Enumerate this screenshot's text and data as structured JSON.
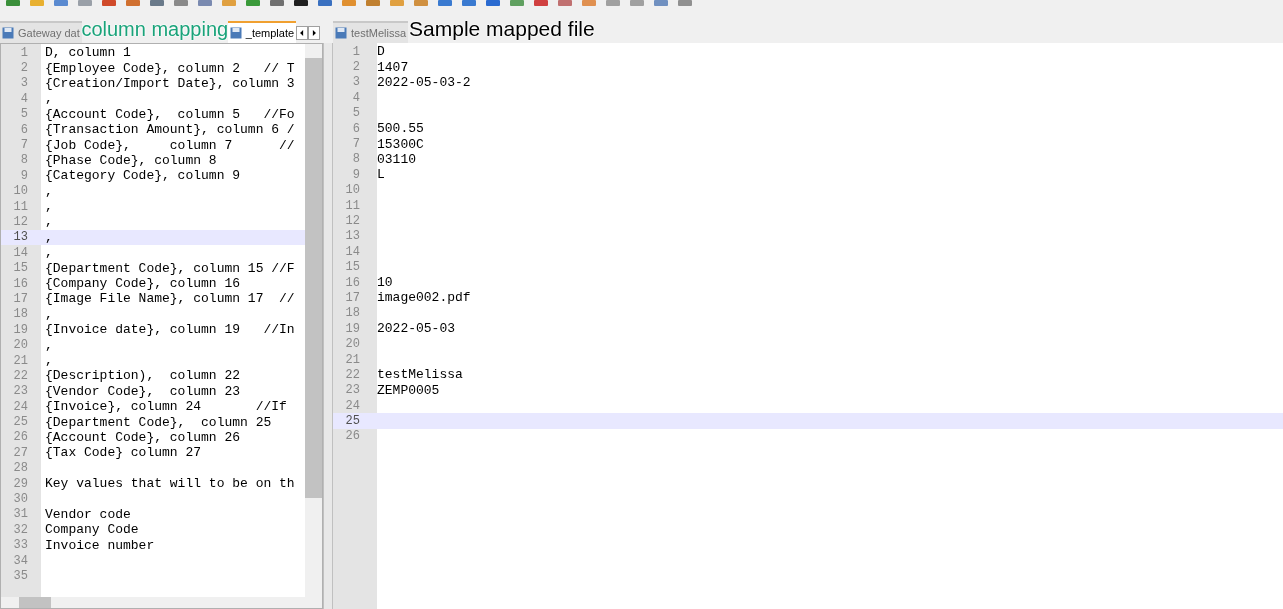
{
  "annotations": [
    {
      "text": "column mapping",
      "kind": "green"
    },
    {
      "text": "Sample mapped file",
      "kind": "dark"
    }
  ],
  "left_pane": {
    "tabs": [
      {
        "label": "Gateway dat",
        "selected": false
      },
      {
        "label": "_template",
        "selected": true
      }
    ],
    "lines": [
      {
        "n": "1",
        "text": "D, column 1",
        "selected": false
      },
      {
        "n": "2",
        "text": "{Employee Code}, column 2   // T",
        "selected": false
      },
      {
        "n": "3",
        "text": "{Creation/Import Date}, column 3",
        "selected": false
      },
      {
        "n": "4",
        "text": ",",
        "selected": false
      },
      {
        "n": "5",
        "text": "{Account Code},  column 5   //Fo",
        "selected": false
      },
      {
        "n": "6",
        "text": "{Transaction Amount}, column 6 /",
        "selected": false
      },
      {
        "n": "7",
        "text": "{Job Code},     column 7      //",
        "selected": false
      },
      {
        "n": "8",
        "text": "{Phase Code}, column 8",
        "selected": false
      },
      {
        "n": "9",
        "text": "{Category Code}, column 9",
        "selected": false
      },
      {
        "n": "10",
        "text": ",",
        "selected": false
      },
      {
        "n": "11",
        "text": ",",
        "selected": false
      },
      {
        "n": "12",
        "text": ",",
        "selected": false
      },
      {
        "n": "13",
        "text": ",",
        "selected": true
      },
      {
        "n": "14",
        "text": ",",
        "selected": false
      },
      {
        "n": "15",
        "text": "{Department Code}, column 15 //F",
        "selected": false
      },
      {
        "n": "16",
        "text": "{Company Code}, column 16",
        "selected": false
      },
      {
        "n": "17",
        "text": "{Image File Name}, column 17  //",
        "selected": false
      },
      {
        "n": "18",
        "text": ",",
        "selected": false
      },
      {
        "n": "19",
        "text": "{Invoice date}, column 19   //In",
        "selected": false
      },
      {
        "n": "20",
        "text": ",",
        "selected": false
      },
      {
        "n": "21",
        "text": ",",
        "selected": false
      },
      {
        "n": "22",
        "text": "{Description),  column 22",
        "selected": false
      },
      {
        "n": "23",
        "text": "{Vendor Code},  column 23",
        "selected": false
      },
      {
        "n": "24",
        "text": "{Invoice}, column 24       //If",
        "selected": false
      },
      {
        "n": "25",
        "text": "{Department Code},  column 25",
        "selected": false
      },
      {
        "n": "26",
        "text": "{Account Code}, column 26",
        "selected": false
      },
      {
        "n": "27",
        "text": "{Tax Code} column 27",
        "selected": false
      },
      {
        "n": "28",
        "selected": false
      },
      {
        "n": "29",
        "text": "Key values that will to be on th",
        "selected": false
      },
      {
        "n": "30",
        "selected": false
      },
      {
        "n": "31",
        "text": "Vendor code",
        "selected": false
      },
      {
        "n": "32",
        "text": "Company Code",
        "selected": false
      },
      {
        "n": "33",
        "text": "Invoice number",
        "selected": false
      },
      {
        "n": "34",
        "selected": false
      },
      {
        "n": "35",
        "selected": false
      }
    ]
  },
  "right_pane": {
    "tabs": [
      {
        "label": "testMelissa",
        "selected": false
      }
    ],
    "lines": [
      {
        "n": "1",
        "text": "D",
        "selected": false
      },
      {
        "n": "2",
        "text": "1407",
        "selected": false
      },
      {
        "n": "3",
        "text": "2022-05-03-2",
        "selected": false
      },
      {
        "n": "4",
        "selected": false
      },
      {
        "n": "5",
        "selected": false
      },
      {
        "n": "6",
        "text": "500.55",
        "selected": false
      },
      {
        "n": "7",
        "text": "15300C",
        "selected": false
      },
      {
        "n": "8",
        "text": "03110",
        "selected": false
      },
      {
        "n": "9",
        "text": "L",
        "selected": false
      },
      {
        "n": "10",
        "selected": false
      },
      {
        "n": "11",
        "selected": false
      },
      {
        "n": "12",
        "selected": false
      },
      {
        "n": "13",
        "selected": false
      },
      {
        "n": "14",
        "selected": false
      },
      {
        "n": "15",
        "selected": false
      },
      {
        "n": "16",
        "text": "10",
        "selected": false
      },
      {
        "n": "17",
        "text": "image002.pdf",
        "selected": false
      },
      {
        "n": "18",
        "selected": false
      },
      {
        "n": "19",
        "text": "2022-05-03",
        "selected": false
      },
      {
        "n": "20",
        "selected": false
      },
      {
        "n": "21",
        "selected": false
      },
      {
        "n": "22",
        "text": "testMelissa",
        "selected": false
      },
      {
        "n": "23",
        "text": "ZEMP0005",
        "selected": false
      },
      {
        "n": "24",
        "selected": false
      },
      {
        "n": "25",
        "selected": true
      },
      {
        "n": "26",
        "selected": false
      }
    ]
  }
}
